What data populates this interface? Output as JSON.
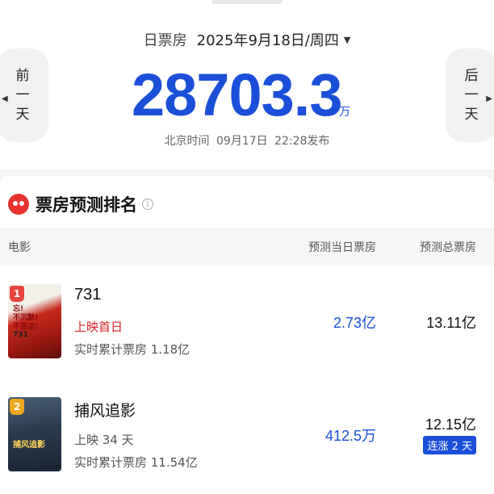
{
  "header": {
    "label": "日票房",
    "date": "2025年9月18日/周四",
    "prev_label": [
      "前",
      "一",
      "天"
    ],
    "next_label": [
      "后",
      "一",
      "天"
    ],
    "total": "28703.3",
    "unit": "万",
    "publish_text": "北京时间 09月17日 22:28发布"
  },
  "panel": {
    "title": "票房预测排名",
    "info_icon": "info-icon",
    "columns": {
      "film": "电影",
      "day": "预测当日票房",
      "total": "预测总票房"
    }
  },
  "films": [
    {
      "rank": "1",
      "name": "731",
      "status": "上映首日",
      "cumulative": "实时累计票房 1.18亿",
      "pred_day": "2.73亿",
      "pred_total": "13.11亿",
      "badge": ""
    },
    {
      "rank": "2",
      "name": "捕风追影",
      "status": "上映 34 天",
      "cumulative": "实时累计票房 11.54亿",
      "pred_day": "412.5万",
      "pred_total": "12.15亿",
      "badge": "连涨 2 天"
    }
  ],
  "poster_text": {
    "p1_line1": "忘!",
    "p1_line2": "不沉默!",
    "p1_line3": "不原谅!",
    "p1_num": "731"
  },
  "colors": {
    "accent": "#1b4fd8",
    "red": "#d8232a",
    "rank1": "#e8453c",
    "rank2": "#f0a51e"
  }
}
